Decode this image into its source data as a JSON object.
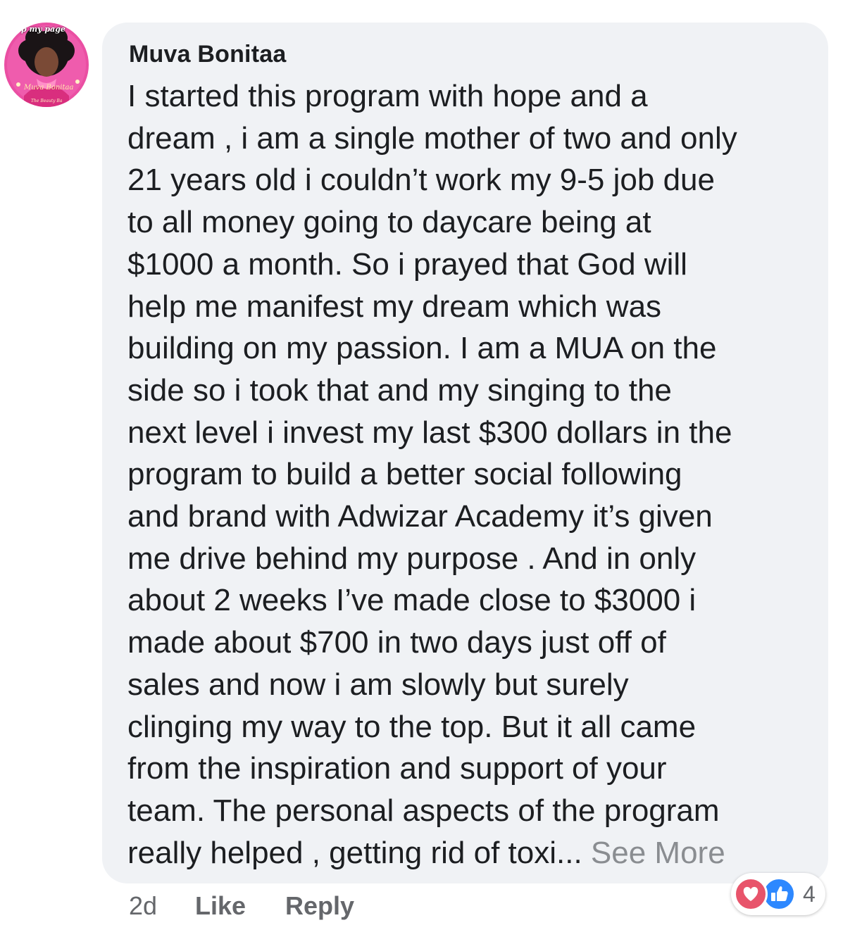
{
  "avatar": {
    "caption_top": "p my page",
    "caption_mid": "Muva Bonitaa",
    "caption_low": "The Beauty Ba"
  },
  "comment": {
    "author": "Muva Bonitaa",
    "lines": [
      "I started this program with hope and a",
      "dream , i am a single mother of two and only",
      "21 years old i couldn’t work my 9-5 job due",
      "to all money going to daycare being at",
      "$1000 a month. So i prayed that God will",
      "help me manifest my dream which was",
      "building on my passion. I am a MUA on the",
      "side so i took that and my singing to the",
      "next level i invest my last $300 dollars in the",
      "program to build a better social following",
      "and brand with Adwizar Academy it’s given",
      "me drive behind my purpose . And in only",
      "about 2 weeks I’ve made close to $3000 i",
      "made about $700 in two days just off of",
      "sales and now i am slowly but surely",
      "clinging my way to the top. But it all came",
      "from the inspiration and support of your",
      "team. The personal aspects of the program"
    ],
    "last_line": "really helped , getting rid of toxi... ",
    "see_more": "See More"
  },
  "actions": {
    "time": "2d",
    "like_label": "Like",
    "reply_label": "Reply"
  },
  "reactions": {
    "icons": [
      "heart-icon",
      "thumbs-up-icon"
    ],
    "count": "4"
  },
  "colors": {
    "bubble_bg": "#f0f2f5",
    "text": "#1c1e21",
    "secondary_text": "#65676b",
    "see_more": "#8a8d91",
    "love": "#e8546b",
    "like": "#2d88ff",
    "avatar_pink": "#ea4fa3"
  }
}
